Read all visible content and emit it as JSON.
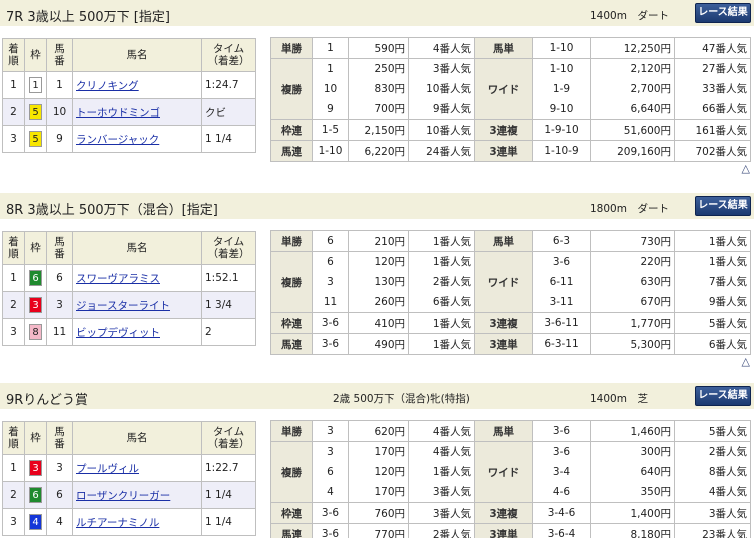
{
  "labels": {
    "result_button": "レース結果",
    "up_icon": "△",
    "finish_headers": [
      "着順",
      "枠",
      "馬番",
      "馬名",
      "タイム（着差）"
    ]
  },
  "colors": {
    "waku_1": "#ffffff",
    "waku_3": "#e8001c",
    "waku_4": "#1536d8",
    "waku_5": "#f7e600",
    "waku_6": "#1f8a2e",
    "waku_8": "#f4b8c8"
  },
  "races": [
    {
      "title": "7R 3歳以上 500万下 [指定]",
      "cond": "",
      "distance": "1400m　ダート",
      "finishers": [
        {
          "pos": "1",
          "waku": "1",
          "num": "1",
          "name": "クリノキング",
          "time": "1:24.7"
        },
        {
          "pos": "2",
          "waku": "5",
          "num": "10",
          "name": "トーホウドミンゴ",
          "time": "クビ"
        },
        {
          "pos": "3",
          "waku": "5",
          "num": "9",
          "name": "ランバージャック",
          "time": "1 1/4"
        }
      ],
      "payouts": {
        "tansho": {
          "label": "単勝",
          "nums": [
            "1"
          ],
          "pays": [
            "590円"
          ],
          "pops": [
            "4番人気"
          ]
        },
        "fukusho": {
          "label": "複勝",
          "nums": [
            "1",
            "10",
            "9"
          ],
          "pays": [
            "250円",
            "830円",
            "700円"
          ],
          "pops": [
            "3番人気",
            "10番人気",
            "9番人気"
          ]
        },
        "wakuren": {
          "label": "枠連",
          "nums": [
            "1-5"
          ],
          "pays": [
            "2,150円"
          ],
          "pops": [
            "10番人気"
          ]
        },
        "umaren": {
          "label": "馬連",
          "nums": [
            "1-10"
          ],
          "pays": [
            "6,220円"
          ],
          "pops": [
            "24番人気"
          ]
        },
        "umatan": {
          "label": "馬単",
          "nums": [
            "1-10"
          ],
          "pays": [
            "12,250円"
          ],
          "pops": [
            "47番人気"
          ]
        },
        "wide": {
          "label": "ワイド",
          "nums": [
            "1-10",
            "1-9",
            "9-10"
          ],
          "pays": [
            "2,120円",
            "2,700円",
            "6,640円"
          ],
          "pops": [
            "27番人気",
            "33番人気",
            "66番人気"
          ]
        },
        "sanrenpuku": {
          "label": "3連複",
          "nums": [
            "1-9-10"
          ],
          "pays": [
            "51,600円"
          ],
          "pops": [
            "161番人気"
          ]
        },
        "sanrentan": {
          "label": "3連単",
          "nums": [
            "1-10-9"
          ],
          "pays": [
            "209,160円"
          ],
          "pops": [
            "702番人気"
          ]
        }
      }
    },
    {
      "title": "8R 3歳以上 500万下（混合）[指定]",
      "cond": "",
      "distance": "1800m　ダート",
      "finishers": [
        {
          "pos": "1",
          "waku": "6",
          "num": "6",
          "name": "スワーヴアラミス",
          "time": "1:52.1"
        },
        {
          "pos": "2",
          "waku": "3",
          "num": "3",
          "name": "ジョースターライト",
          "time": "1 3/4"
        },
        {
          "pos": "3",
          "waku": "8",
          "num": "11",
          "name": "ビップデヴィット",
          "time": "2"
        }
      ],
      "payouts": {
        "tansho": {
          "label": "単勝",
          "nums": [
            "6"
          ],
          "pays": [
            "210円"
          ],
          "pops": [
            "1番人気"
          ]
        },
        "fukusho": {
          "label": "複勝",
          "nums": [
            "6",
            "3",
            "11"
          ],
          "pays": [
            "120円",
            "130円",
            "260円"
          ],
          "pops": [
            "1番人気",
            "2番人気",
            "6番人気"
          ]
        },
        "wakuren": {
          "label": "枠連",
          "nums": [
            "3-6"
          ],
          "pays": [
            "410円"
          ],
          "pops": [
            "1番人気"
          ]
        },
        "umaren": {
          "label": "馬連",
          "nums": [
            "3-6"
          ],
          "pays": [
            "490円"
          ],
          "pops": [
            "1番人気"
          ]
        },
        "umatan": {
          "label": "馬単",
          "nums": [
            "6-3"
          ],
          "pays": [
            "730円"
          ],
          "pops": [
            "1番人気"
          ]
        },
        "wide": {
          "label": "ワイド",
          "nums": [
            "3-6",
            "6-11",
            "3-11"
          ],
          "pays": [
            "220円",
            "630円",
            "670円"
          ],
          "pops": [
            "1番人気",
            "7番人気",
            "9番人気"
          ]
        },
        "sanrenpuku": {
          "label": "3連複",
          "nums": [
            "3-6-11"
          ],
          "pays": [
            "1,770円"
          ],
          "pops": [
            "5番人気"
          ]
        },
        "sanrentan": {
          "label": "3連単",
          "nums": [
            "6-3-11"
          ],
          "pays": [
            "5,300円"
          ],
          "pops": [
            "6番人気"
          ]
        }
      }
    },
    {
      "title": "9Rりんどう賞",
      "cond": "2歳 500万下（混合)牝(特指)",
      "distance": "1400m　芝",
      "finishers": [
        {
          "pos": "1",
          "waku": "3",
          "num": "3",
          "name": "プールヴィル",
          "time": "1:22.7"
        },
        {
          "pos": "2",
          "waku": "6",
          "num": "6",
          "name": "ローザンクリーガー",
          "time": "1 1/4"
        },
        {
          "pos": "3",
          "waku": "4",
          "num": "4",
          "name": "ルチアーナミノル",
          "time": "1 1/4"
        }
      ],
      "payouts": {
        "tansho": {
          "label": "単勝",
          "nums": [
            "3"
          ],
          "pays": [
            "620円"
          ],
          "pops": [
            "4番人気"
          ]
        },
        "fukusho": {
          "label": "複勝",
          "nums": [
            "3",
            "6",
            "4"
          ],
          "pays": [
            "170円",
            "120円",
            "170円"
          ],
          "pops": [
            "4番人気",
            "1番人気",
            "3番人気"
          ]
        },
        "wakuren": {
          "label": "枠連",
          "nums": [
            "3-6"
          ],
          "pays": [
            "760円"
          ],
          "pops": [
            "3番人気"
          ]
        },
        "umaren": {
          "label": "馬連",
          "nums": [
            "3-6"
          ],
          "pays": [
            "770円"
          ],
          "pops": [
            "2番人気"
          ]
        },
        "umatan": {
          "label": "馬単",
          "nums": [
            "3-6"
          ],
          "pays": [
            "1,460円"
          ],
          "pops": [
            "5番人気"
          ]
        },
        "wide": {
          "label": "ワイド",
          "nums": [
            "3-6",
            "3-4",
            "4-6"
          ],
          "pays": [
            "300円",
            "640円",
            "350円"
          ],
          "pops": [
            "2番人気",
            "8番人気",
            "4番人気"
          ]
        },
        "sanrenpuku": {
          "label": "3連複",
          "nums": [
            "3-4-6"
          ],
          "pays": [
            "1,400円"
          ],
          "pops": [
            "3番人気"
          ]
        },
        "sanrentan": {
          "label": "3連単",
          "nums": [
            "3-6-4"
          ],
          "pays": [
            "8,180円"
          ],
          "pops": [
            "23番人気"
          ]
        }
      }
    }
  ]
}
